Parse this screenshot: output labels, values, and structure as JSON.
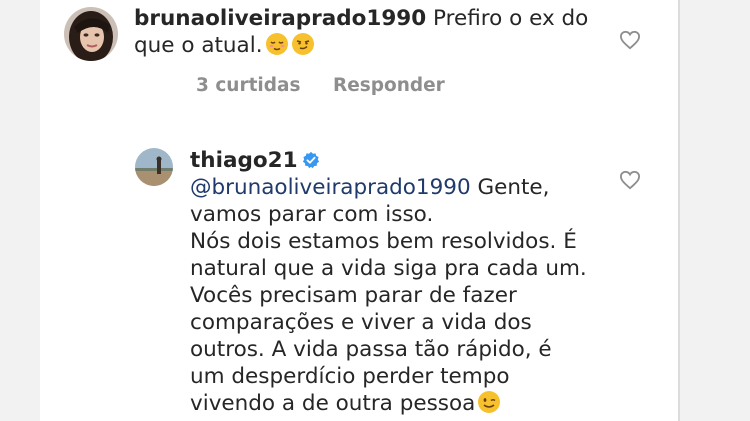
{
  "comments": [
    {
      "username": "brunaoliveiraprado1990",
      "text_line1": " Prefiro o ex do",
      "text_line2": "que o atual.",
      "emojis": [
        "relieved-face-emoji",
        "smirking-face-emoji"
      ],
      "likes_label": "3 curtidas",
      "reply_label": "Responder",
      "avatar_icon": "profile-photo-woman"
    },
    {
      "username": "thiago21",
      "verified": true,
      "mention": "@brunaoliveiraprado1990",
      "lines": [
        " Gente,",
        "vamos parar com isso.",
        "Nós dois estamos bem resolvidos. É",
        "natural que a vida siga pra cada um.",
        "Vocês precisam parar de fazer",
        "comparações e viver a vida dos",
        "outros. A vida passa tão rápido, é",
        "um desperdício perder tempo",
        "vivendo a de outra pessoa"
      ],
      "end_emoji": "winking-face-emoji",
      "avatar_icon": "profile-photo-outdoor"
    }
  ],
  "colors": {
    "text": "#262626",
    "muted": "#8e8e8e",
    "mention": "#1f3a6b",
    "verified": "#3897f0",
    "emoji_yellow": "#f7c12e"
  }
}
